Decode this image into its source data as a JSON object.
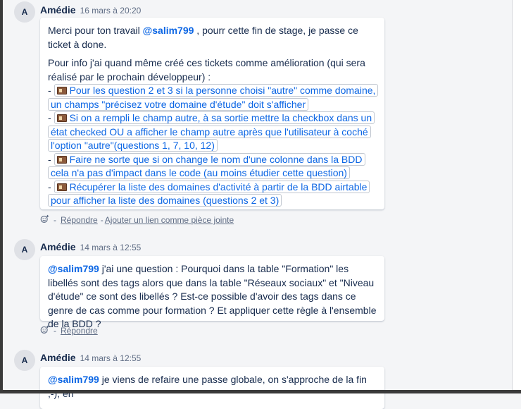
{
  "comments": [
    {
      "avatar": "A",
      "author": "Amédie",
      "time": "16 mars à 20:20",
      "intro_before_mention": "Merci pour ton travail ",
      "mention": "@salim799",
      "intro_after_mention": " , pourr cette fin de stage, je passe ce ticket à done.",
      "info": "Pour info j'ai quand même créé ces tickets comme amélioration (qui sera réalisé par le prochain développeur) :",
      "bullet_prefix": "- ",
      "tickets": [
        "Pour les question 2 et 3 si la personne choisi \"autre\" comme domaine, un champs \"précisez votre domaine d'étude\" doit s'afficher",
        "Si on a rempli le champ autre, à sa sortie mettre la checkbox dans un état checked OU a afficher le champ autre après que l'utilisateur à coché l'option \"autre\"(questions 1, 7, 10, 12)",
        "Faire ne sorte que si on change le nom d'une colonne dans la BDD cela n'a pas d'impact dans le code (au moins étudier cette question)",
        "Récupérer la liste des domaines d'activité à partir de la BDD airtable pour afficher la liste des domaines (questions 2 et 3)"
      ],
      "actions": {
        "separator": "-",
        "reply": "Répondre",
        "attach": "Ajouter un lien comme pièce jointe"
      }
    },
    {
      "avatar": "A",
      "author": "Amédie",
      "time": "14 mars à 12:55",
      "mention": "@salim799",
      "text": " j'ai une question : Pourquoi dans la table \"Formation\" les libellés sont des tags alors que dans la table \"Réseaux sociaux\" et \"Niveau d'étude\" ce sont des libellés ? Est-ce possible d'avoir des tags dans ce genre de cas comme pour formation ? Et appliquer cette règle à l'ensemble de la BDD ?",
      "actions": {
        "separator": "-",
        "reply": "Répondre"
      }
    },
    {
      "avatar": "A",
      "author": "Amédie",
      "time": "14 mars à 12:55",
      "mention": "@salim799",
      "text": " je viens de refaire une passe globale, on s'approche de la fin ;-), en"
    }
  ],
  "colors": {
    "background": "#f4f5f7",
    "card": "#ffffff",
    "link": "#0c66e4",
    "text": "#172b4d",
    "muted": "#5e6c84"
  },
  "icons": {
    "reaction": "add-reaction-icon",
    "ticket": "trello-card-icon"
  }
}
